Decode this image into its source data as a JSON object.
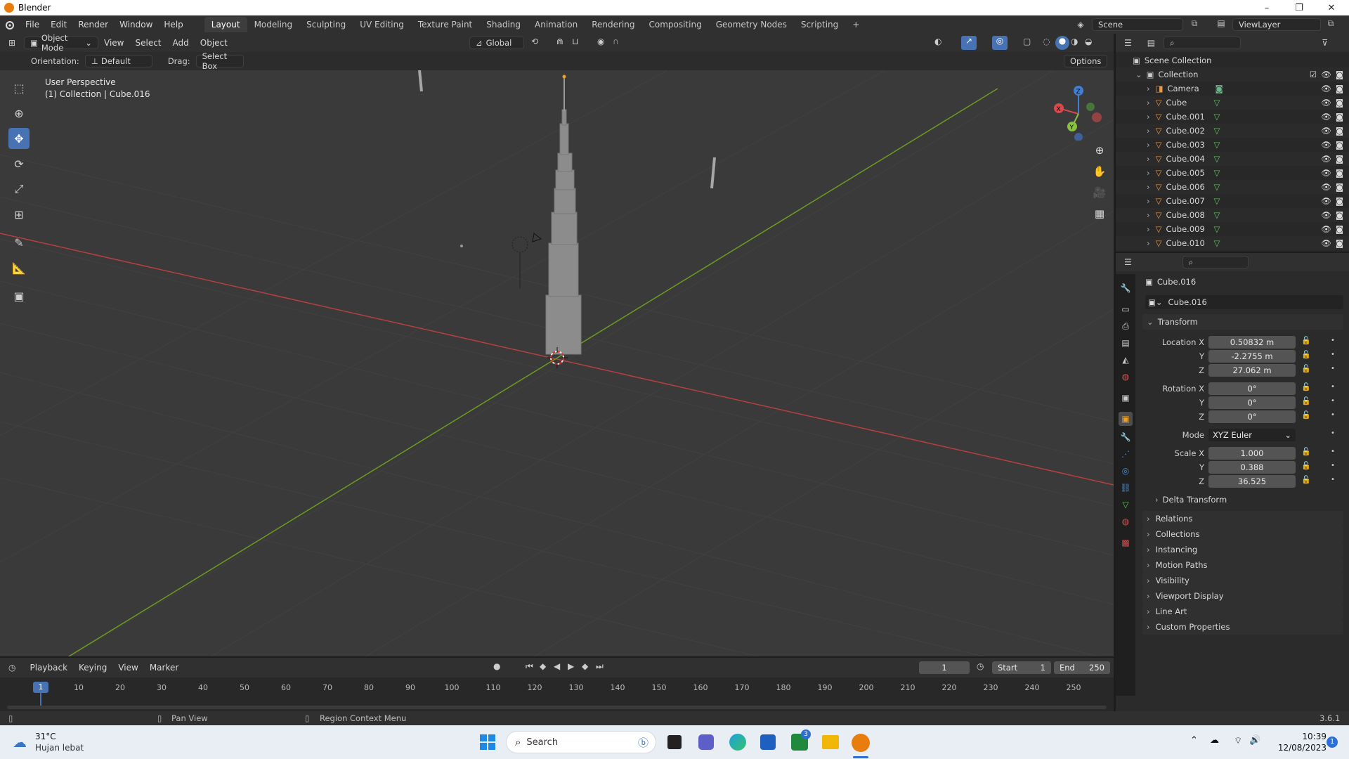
{
  "window": {
    "title": "Blender",
    "minimize": "–",
    "maximize": "❐",
    "close": "✕"
  },
  "menus": [
    "File",
    "Edit",
    "Render",
    "Window",
    "Help"
  ],
  "workspaces": [
    "Layout",
    "Modeling",
    "Sculpting",
    "UV Editing",
    "Texture Paint",
    "Shading",
    "Animation",
    "Rendering",
    "Compositing",
    "Geometry Nodes",
    "Scripting"
  ],
  "active_workspace": "Layout",
  "add_workspace": "+",
  "scene": {
    "name": "Scene",
    "view_layer": "ViewLayer"
  },
  "viewport_header": {
    "mode": "Object Mode",
    "menus": [
      "View",
      "Select",
      "Add",
      "Object"
    ],
    "transform_orientation": "Global",
    "orientation_label": "Orientation:",
    "orientation_value": "Default",
    "drag_label": "Drag:",
    "drag_value": "Select Box",
    "options": "Options"
  },
  "viewport": {
    "perspective": "User Perspective",
    "context": "(1) Collection | Cube.016",
    "colors": {
      "bg": "#393939",
      "x_axis": "#c83c3c",
      "y_axis": "#6c9b22",
      "grid": "#444444",
      "selection": "#f0a020"
    }
  },
  "outliner": {
    "root": "Scene Collection",
    "collection": "Collection",
    "items": [
      "Camera",
      "Cube",
      "Cube.001",
      "Cube.002",
      "Cube.003",
      "Cube.004",
      "Cube.005",
      "Cube.006",
      "Cube.007",
      "Cube.008",
      "Cube.009",
      "Cube.010"
    ]
  },
  "properties": {
    "object_name": "Cube.016",
    "object_datablock": "Cube.016",
    "transform_title": "Transform",
    "location": {
      "label": "Location X",
      "x": "0.50832 m",
      "y": "-2.2755 m",
      "z": "27.062 m"
    },
    "rotation": {
      "label": "Rotation X",
      "x": "0°",
      "y": "0°",
      "z": "0°"
    },
    "mode_label": "Mode",
    "mode_value": "XYZ Euler",
    "scale": {
      "label": "Scale X",
      "x": "1.000",
      "y": "0.388",
      "z": "36.525"
    },
    "axis_y": "Y",
    "axis_z": "Z",
    "delta_transform": "Delta Transform",
    "panels": [
      "Relations",
      "Collections",
      "Instancing",
      "Motion Paths",
      "Visibility",
      "Viewport Display",
      "Line Art",
      "Custom Properties"
    ]
  },
  "timeline": {
    "menus": [
      "Playback",
      "Keying",
      "View",
      "Marker"
    ],
    "current_frame": "1",
    "start_label": "Start",
    "start": "1",
    "end_label": "End",
    "end": "250",
    "ticks": [
      "10",
      "20",
      "30",
      "40",
      "50",
      "60",
      "70",
      "80",
      "90",
      "100",
      "110",
      "120",
      "130",
      "140",
      "150",
      "160",
      "170",
      "180",
      "190",
      "200",
      "210",
      "220",
      "230",
      "240",
      "250"
    ],
    "frame_indicator": "1"
  },
  "statusbar": {
    "pan": "Pan View",
    "context_menu": "Region Context Menu",
    "version": "3.6.1"
  },
  "taskbar": {
    "weather_temp": "31°C",
    "weather_desc": "Hujan lebat",
    "search_placeholder": "Search",
    "badge": "3",
    "time": "10:39",
    "date": "12/08/2023",
    "notif": "1"
  }
}
